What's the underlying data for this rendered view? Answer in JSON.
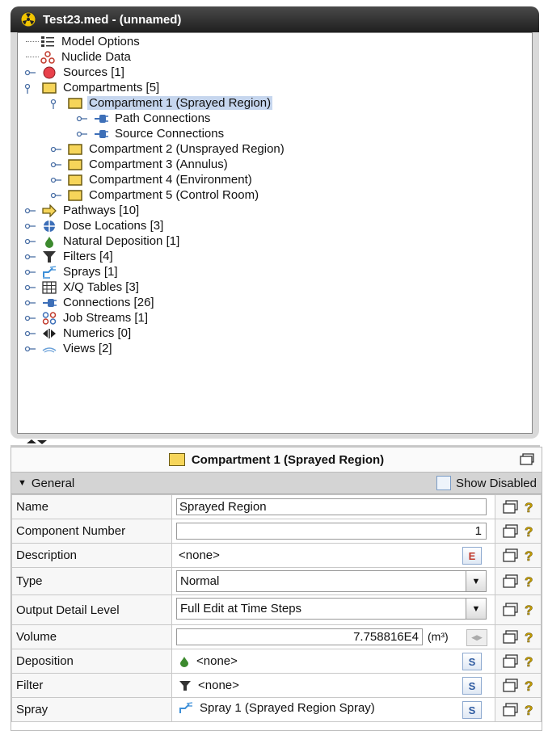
{
  "window": {
    "title": "Test23.med - (unnamed)"
  },
  "tree": {
    "model_options": "Model Options",
    "nuclide_data": "Nuclide Data",
    "sources": "Sources [1]",
    "compartments": "Compartments [5]",
    "compartment_1": "Compartment 1 (Sprayed Region)",
    "path_connections": "Path Connections",
    "source_connections": "Source Connections",
    "compartment_2": "Compartment 2 (Unsprayed Region)",
    "compartment_3": "Compartment 3 (Annulus)",
    "compartment_4": "Compartment 4 (Environment)",
    "compartment_5": "Compartment 5 (Control Room)",
    "pathways": "Pathways [10]",
    "dose_locations": "Dose Locations [3]",
    "natural_deposition": "Natural Deposition [1]",
    "filters": "Filters [4]",
    "sprays": "Sprays [1]",
    "xq_tables": "X/Q Tables [3]",
    "connections": "Connections [26]",
    "job_streams": "Job Streams [1]",
    "numerics": "Numerics [0]",
    "views": "Views [2]"
  },
  "panel": {
    "title": "Compartment 1 (Sprayed Region)",
    "section": "General",
    "show_disabled": "Show Disabled",
    "name_label": "Name",
    "name_value": "Sprayed Region",
    "component_number_label": "Component Number",
    "component_number_value": "1",
    "description_label": "Description",
    "description_value": "<none>",
    "description_btn": "E",
    "type_label": "Type",
    "type_value": "Normal",
    "output_label": "Output Detail Level",
    "output_value": "Full Edit at Time Steps",
    "volume_label": "Volume",
    "volume_value": "7.758816E4",
    "volume_unit": "(m³)",
    "deposition_label": "Deposition",
    "deposition_value": "<none>",
    "filter_label": "Filter",
    "filter_value": "<none>",
    "spray_label": "Spray",
    "spray_value": "Spray 1 (Sprayed Region Spray)",
    "select_btn": "S"
  },
  "colors": {
    "selection": "#c6d6ee",
    "compartment_fill": "#f6d55a",
    "titlebar": "#2b2b2b"
  },
  "icons": [
    "radiation-icon",
    "options-list-icon",
    "nuclide-icon",
    "source-icon",
    "folder-icon",
    "connector-icon",
    "pathway-arrow-icon",
    "crosshair-icon",
    "droplet-icon",
    "filter-icon",
    "spray-icon",
    "table-icon",
    "job-stream-icon",
    "numerics-icon",
    "views-icon",
    "pin-icon",
    "help-icon"
  ]
}
